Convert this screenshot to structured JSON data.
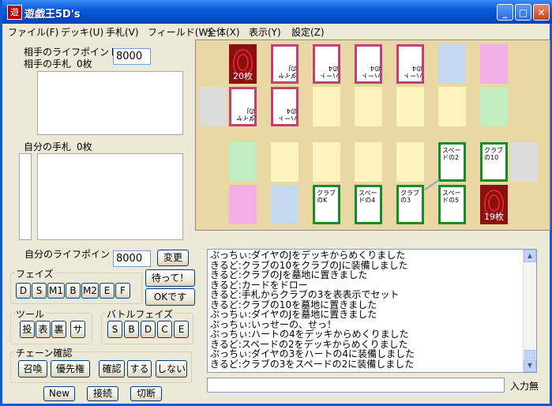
{
  "window": {
    "title": "遊戯王5D's",
    "icon": "遊"
  },
  "menu": [
    "ファイル(F)",
    "デッキ(U)",
    "手札(V)",
    "フィールド(W)",
    "全体(X)",
    "表示(Y)",
    "設定(Z)"
  ],
  "opponent": {
    "life_label": "相手のライフポイント",
    "hand_label": "相手の手札",
    "hand_count": "0枚",
    "life_value": "8000"
  },
  "self": {
    "hand_label": "自分の手札",
    "hand_count": "0枚",
    "life_label": "自分のライフポイント",
    "life_value": "8000"
  },
  "buttons": {
    "change": "変更",
    "wait": "待って！",
    "ok": "OKです",
    "new": "New",
    "connect": "接続",
    "disconnect": "切断"
  },
  "phase": {
    "title": "フェイズ",
    "items": [
      "D",
      "S",
      "M1",
      "B",
      "M2",
      "E",
      "F"
    ]
  },
  "tools": {
    "title": "ツール",
    "items": [
      "投",
      "表",
      "裏",
      "サ"
    ]
  },
  "battle": {
    "title": "バトルフェイズ",
    "items": [
      "S",
      "B",
      "D",
      "C",
      "E"
    ]
  },
  "chain": {
    "title": "チェーン確認",
    "items": [
      "召喚",
      "優先権",
      "確認",
      "する",
      "しない"
    ]
  },
  "board": {
    "opp_deck_count": "20枚",
    "own_deck_count": "19枚",
    "opp_cards": [
      "ダイヤのJ",
      "ハートの4",
      "ハートの4",
      "ハートの4",
      "ダイヤのJ",
      "ハートの4"
    ],
    "own_cards": [
      "スペードの2",
      "クラブの10",
      "クラブのK",
      "スペードの4",
      "クラブの3",
      "スペードの5"
    ]
  },
  "log": [
    "ぷっちぃ:ダイヤのJをデッキからめくりました",
    "きるど:クラブの10をクラブのJに装備しました",
    "きるど:クラブのJを墓地に置きました",
    "きるど:カードをドロー",
    "きるど:手札からクラブの3を表表示でセット",
    "きるど:クラブの10を墓地に置きました",
    "ぷっちぃ:ダイヤのJを墓地に置きました",
    "ぷっちぃ:いっせーの、せっ！",
    "ぷっちぃ:ハートの4をデッキからめくりました",
    "きるど:スペードの2をデッキからめくりました",
    "ぷっちぃ:ダイヤの3をハートの4に装備しました",
    "きるど:クラブの3をスペードの2に装備しました"
  ],
  "input_status": "入力無",
  "colors": {
    "zone_yellow": "#fdf3c0",
    "zone_blue": "#c5d8f2",
    "zone_pink": "#f4b0e6",
    "zone_green": "#c2ecc2",
    "zone_gray": "#dcdcdc"
  }
}
